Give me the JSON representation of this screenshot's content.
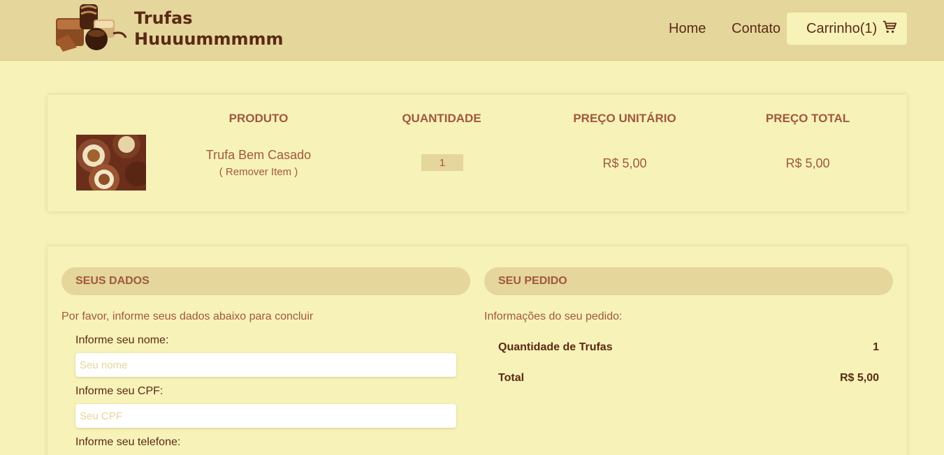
{
  "header": {
    "brand_line1": "Trufas",
    "brand_line2": "Huuuummmmm",
    "nav": {
      "home": "Home",
      "contato": "Contato"
    },
    "cart_label": "Carrinho(1)"
  },
  "cart_table": {
    "headers": {
      "produto": "PRODUTO",
      "quantidade": "QUANTIDADE",
      "preco_unitario": "PREÇO UNITÁRIO",
      "preco_total": "PREÇO TOTAL"
    },
    "item": {
      "name": "Trufa Bem Casado",
      "remove_label": "( Remover Item )",
      "quantity": "1",
      "unit_price": "R$ 5,00",
      "total_price": "R$ 5,00"
    }
  },
  "seus_dados": {
    "title": "SEUS DADOS",
    "intro": "Por favor, informe seus dados abaixo para concluir",
    "nome_label": "Informe seu nome:",
    "nome_placeholder": "Seu nome",
    "cpf_label": "Informe seu CPF:",
    "cpf_placeholder": "Seu CPF",
    "telefone_label": "Informe seu telefone:"
  },
  "seu_pedido": {
    "title": "SEU PEDIDO",
    "intro": "Informações do seu pedido:",
    "quantidade_label": "Quantidade de Trufas",
    "quantidade_value": "1",
    "total_label": "Total",
    "total_value": "R$ 5,00"
  },
  "colors": {
    "background": "#f7f2b8",
    "header": "#e5d69b",
    "accent_text": "#a0583f",
    "dark_text": "#5a2a14"
  }
}
